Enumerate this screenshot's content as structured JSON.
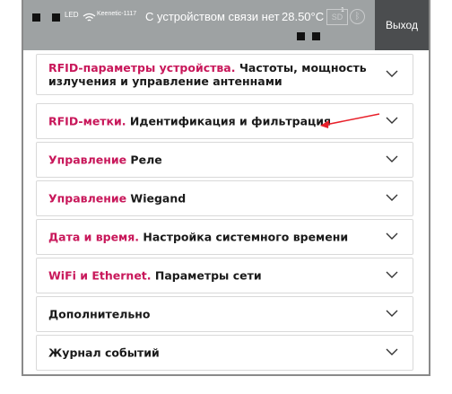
{
  "status_bar": {
    "led_label": "LED",
    "network_name": "Keenetic-1117",
    "connection_status": "С устройством связи нет",
    "temperature": "28.50°C",
    "temperature_superscript": "1",
    "sd_label": "SD",
    "bluetooth_icon": "bluetooth-icon",
    "wifi_icon": "wifi-icon"
  },
  "logout_label": "Выход",
  "accent_color": "#c8175a",
  "panels": [
    {
      "accent": "RFID-параметры устройства.",
      "desc": " Частоты, мощность излучения и управление антеннами"
    },
    {
      "accent": "RFID-метки.",
      "desc": " Идентификация и фильтрация"
    },
    {
      "accent": "Управление",
      "desc": " Реле"
    },
    {
      "accent": "Управление",
      "desc": " Wiegand"
    },
    {
      "accent": "Дата и время.",
      "desc": " Настройка системного времени"
    },
    {
      "accent": "WiFi и Ethernet.",
      "desc": " Параметры сети"
    },
    {
      "accent": "",
      "desc": "Дополнительно"
    },
    {
      "accent": "",
      "desc": "Журнал событий"
    }
  ]
}
